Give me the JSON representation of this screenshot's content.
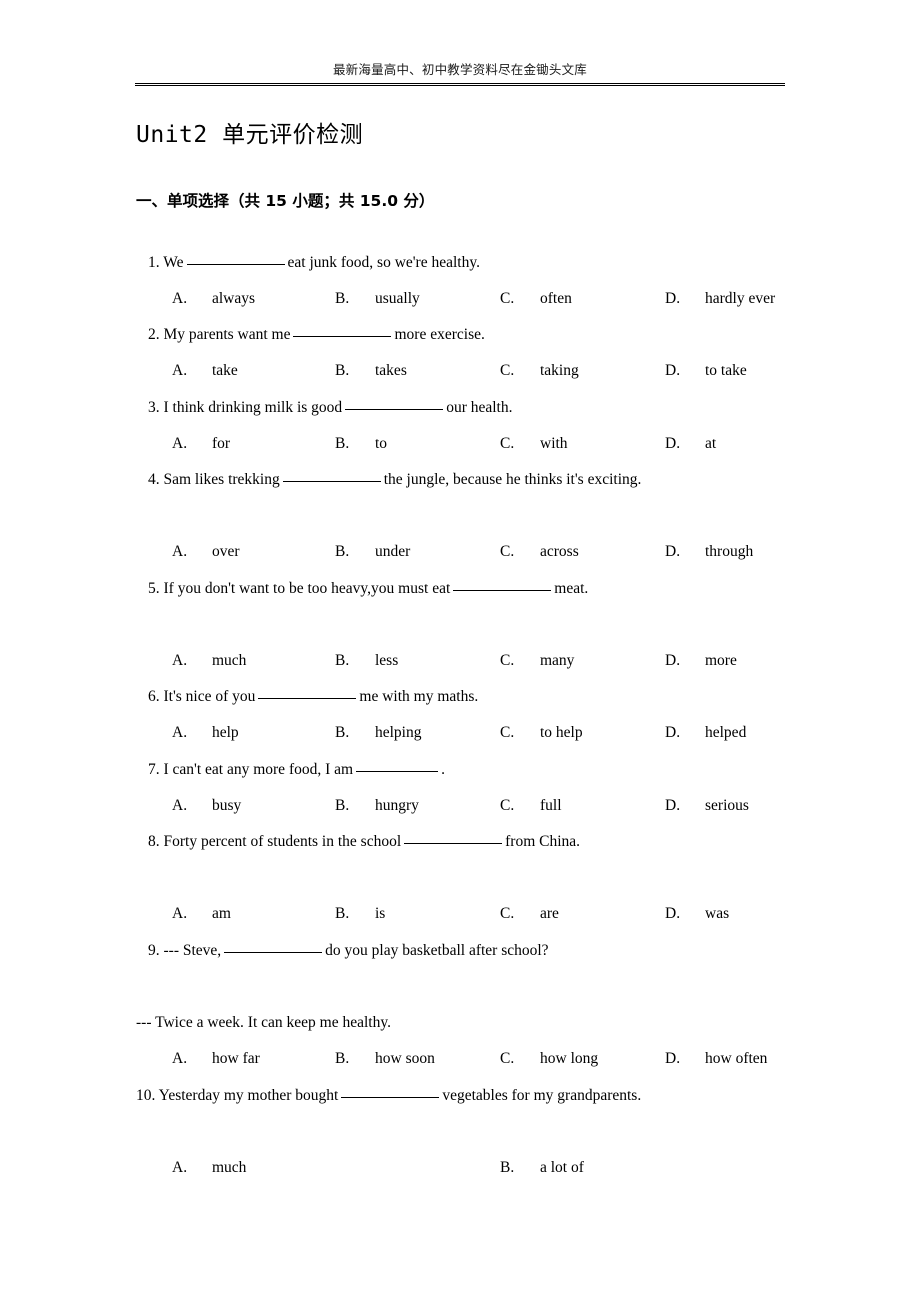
{
  "header": {
    "running_text": "最新海量高中、初中教学资料尽在金锄头文库"
  },
  "title": "Unit2 单元评价检测",
  "section": {
    "heading": "一、单项选择（共 15 小题；共 15.0 分）"
  },
  "questions": [
    {
      "number": "1.",
      "stem_before": "1. We",
      "stem_after": "eat junk food, so we're healthy.",
      "blank": "long",
      "options": [
        {
          "label": "A.",
          "text": "always"
        },
        {
          "label": "B.",
          "text": "usually"
        },
        {
          "label": "C.",
          "text": "often"
        },
        {
          "label": "D.",
          "text": "hardly ever"
        }
      ]
    },
    {
      "number": "2.",
      "stem_before": "2. My parents want me",
      "stem_after": "more exercise.",
      "blank": "long",
      "options": [
        {
          "label": "A.",
          "text": "take"
        },
        {
          "label": "B.",
          "text": "takes"
        },
        {
          "label": "C.",
          "text": "taking"
        },
        {
          "label": "D.",
          "text": "to take"
        }
      ]
    },
    {
      "number": "3.",
      "stem_before": "3. I think drinking milk is good",
      "stem_after": "our health.",
      "blank": "long",
      "options": [
        {
          "label": "A.",
          "text": "for"
        },
        {
          "label": "B.",
          "text": "to"
        },
        {
          "label": "C.",
          "text": "with"
        },
        {
          "label": "D.",
          "text": "at"
        }
      ]
    },
    {
      "number": "4.",
      "stem_before": "4. Sam likes trekking",
      "stem_after": "the jungle, because he thinks it's exciting.",
      "blank": "long",
      "options": [
        {
          "label": "A.",
          "text": "over"
        },
        {
          "label": "B.",
          "text": "under"
        },
        {
          "label": "C.",
          "text": "across"
        },
        {
          "label": "D.",
          "text": "through"
        }
      ]
    },
    {
      "number": "5.",
      "stem_before": "5. If you don't want to be too heavy,you must eat",
      "stem_after": "meat.",
      "blank": "long",
      "options": [
        {
          "label": "A.",
          "text": "much"
        },
        {
          "label": "B.",
          "text": "less"
        },
        {
          "label": "C.",
          "text": "many"
        },
        {
          "label": "D.",
          "text": "more"
        }
      ]
    },
    {
      "number": "6.",
      "stem_before": "6. It's nice of you",
      "stem_after": "me with my maths.",
      "blank": "long",
      "options": [
        {
          "label": "A.",
          "text": "help"
        },
        {
          "label": "B.",
          "text": "helping"
        },
        {
          "label": "C.",
          "text": "to help"
        },
        {
          "label": "D.",
          "text": "helped"
        }
      ]
    },
    {
      "number": "7.",
      "stem_before": "7. I can't eat any more food, I am",
      "stem_after": ".",
      "blank": "short",
      "options": [
        {
          "label": "A.",
          "text": "busy"
        },
        {
          "label": "B.",
          "text": "hungry"
        },
        {
          "label": "C.",
          "text": "full"
        },
        {
          "label": "D.",
          "text": "serious"
        }
      ]
    },
    {
      "number": "8.",
      "stem_before": "8. Forty percent of students in the school",
      "stem_after": "from China.",
      "blank": "long",
      "options": [
        {
          "label": "A.",
          "text": "am"
        },
        {
          "label": "B.",
          "text": "is"
        },
        {
          "label": "C.",
          "text": "are"
        },
        {
          "label": "D.",
          "text": "was"
        }
      ]
    },
    {
      "number": "9.",
      "stem_before": "9. --- Steve,",
      "stem_after": "do you play basketball after school?",
      "blank": "long",
      "reply": "--- Twice a week. It can keep me healthy.",
      "options": [
        {
          "label": "A.",
          "text": "how far"
        },
        {
          "label": "B.",
          "text": "how soon"
        },
        {
          "label": "C.",
          "text": "how long"
        },
        {
          "label": "D.",
          "text": "how often"
        }
      ]
    },
    {
      "number": "10.",
      "stem_before": "10. Yesterday my mother bought",
      "stem_after": "vegetables for my grandparents.",
      "blank": "long",
      "options": [
        {
          "label": "A.",
          "text": "much"
        },
        {
          "label": "B.",
          "text": "a lot of"
        }
      ]
    }
  ]
}
